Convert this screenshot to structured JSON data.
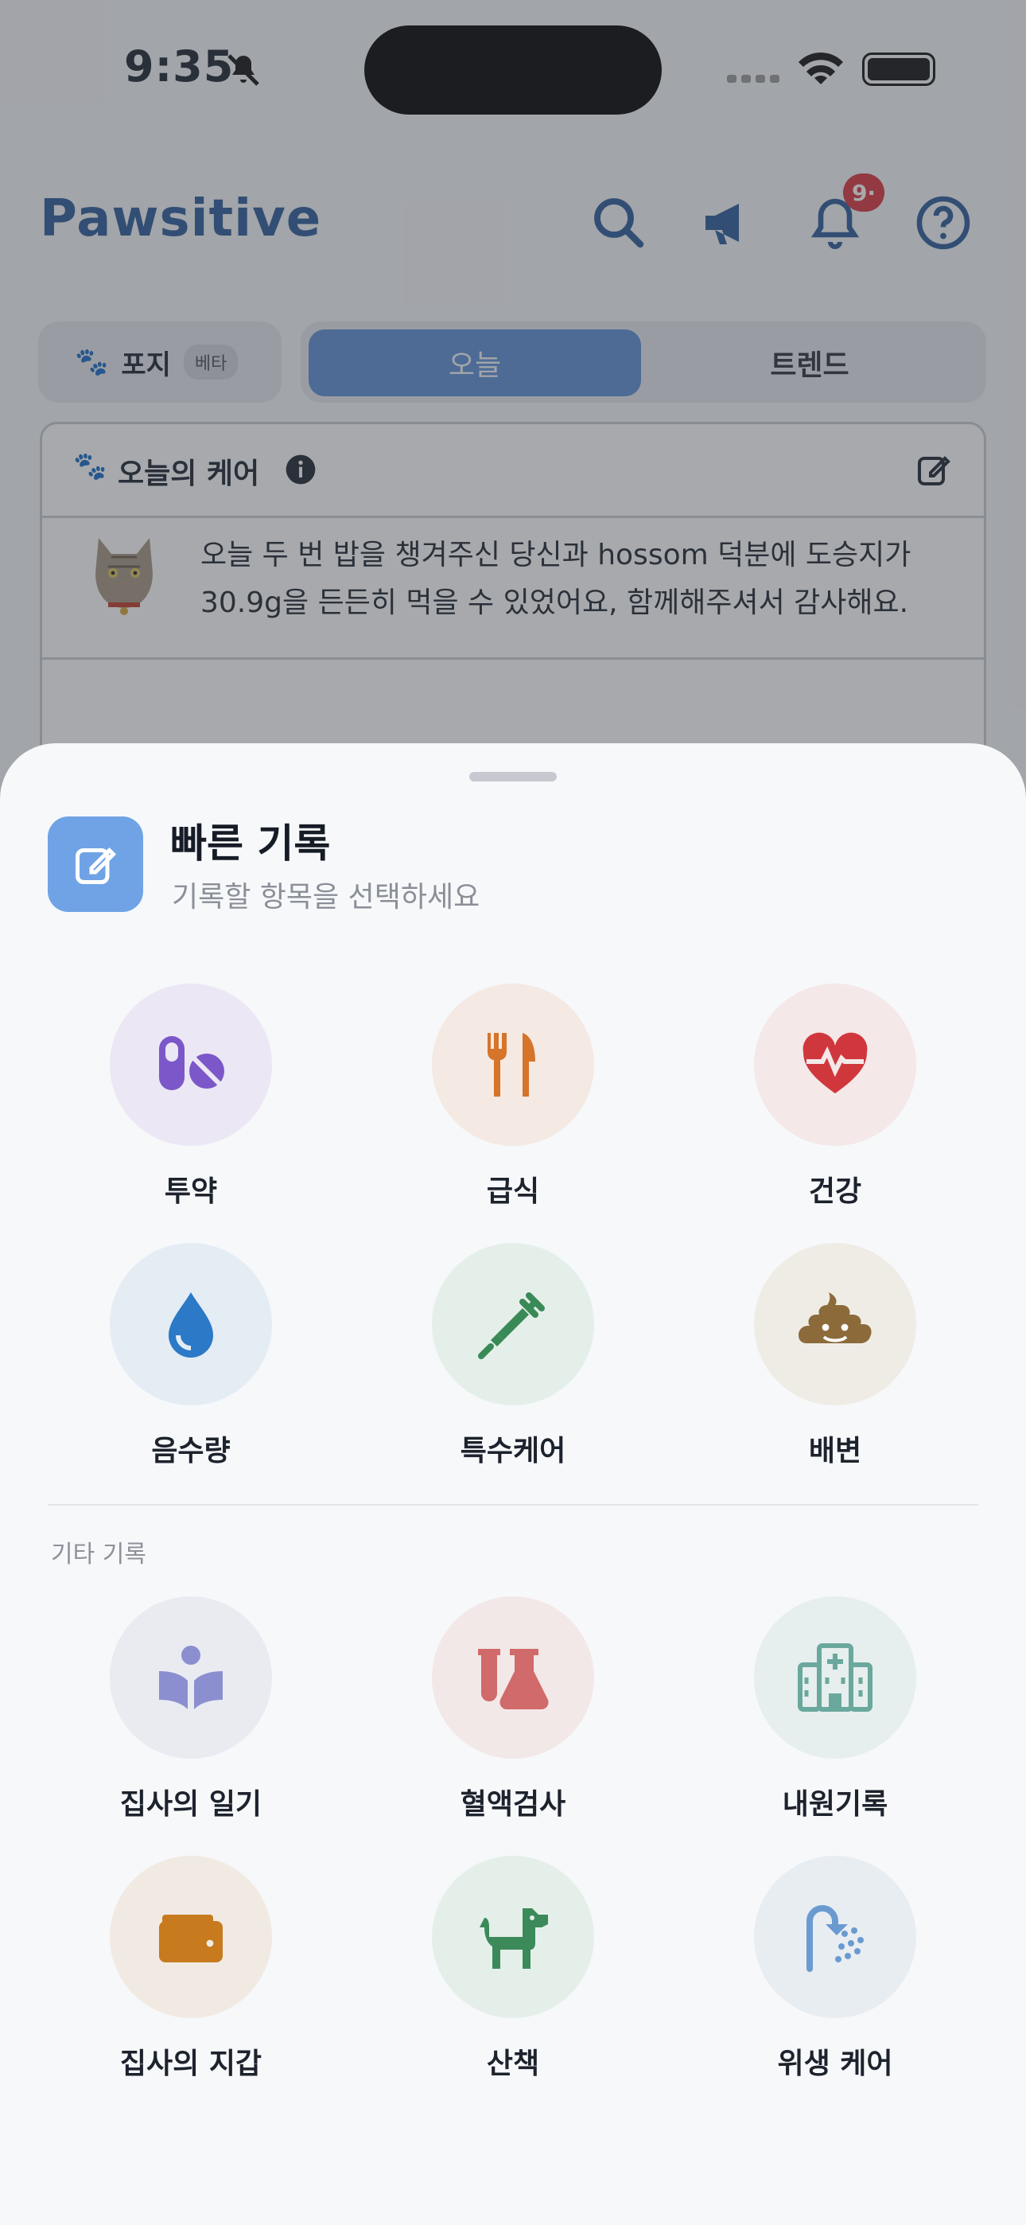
{
  "status_bar": {
    "time": "9:35"
  },
  "app": {
    "brand": "Pawsitive",
    "notification_count": "9·",
    "pet": {
      "name": "포지",
      "tag": "베타"
    },
    "view_tabs": [
      {
        "label": "오늘",
        "selected": true
      },
      {
        "label": "트렌드",
        "selected": false
      }
    ],
    "care_card": {
      "title": "오늘의 케어",
      "message": "오늘 두 번 밥을 챙겨주신 당신과 hossom 덕분에 도승지가 30.9g을 든든히 먹을 수 있었어요, 함께해주셔서 감사해요."
    }
  },
  "sheet": {
    "title": "빠른 기록",
    "subtitle": "기록할 항목을 선택하세요",
    "primary_items": [
      {
        "label": "투약",
        "icon": "pills-icon",
        "color": "#7b57c9",
        "bg": "#ebe7f4"
      },
      {
        "label": "급식",
        "icon": "fork-knife-icon",
        "color": "#d6742a",
        "bg": "#f4e9e3"
      },
      {
        "label": "건강",
        "icon": "heart-pulse-icon",
        "color": "#d0373c",
        "bg": "#f4e8e8"
      },
      {
        "label": "음수량",
        "icon": "water-drop-icon",
        "color": "#2c79c7",
        "bg": "#e4ecf4"
      },
      {
        "label": "특수케어",
        "icon": "syringe-icon",
        "color": "#3a8a57",
        "bg": "#e5efea"
      },
      {
        "label": "배변",
        "icon": "poop-icon",
        "color": "#8c6a3a",
        "bg": "#efece6"
      }
    ],
    "section_label": "기타 기록",
    "other_items": [
      {
        "label": "집사의 일기",
        "icon": "reading-person-icon",
        "color": "#8b8fd0",
        "bg": "#eaebf1"
      },
      {
        "label": "혈액검사",
        "icon": "flask-icon",
        "color": "#d16a6a",
        "bg": "#f3e8e8"
      },
      {
        "label": "내원기록",
        "icon": "hospital-icon",
        "color": "#6aa89d",
        "bg": "#e6eeee"
      },
      {
        "label": "집사의 지갑",
        "icon": "wallet-icon",
        "color": "#c77b1e",
        "bg": "#f1eae3"
      },
      {
        "label": "산책",
        "icon": "dog-icon",
        "color": "#3c8a5a",
        "bg": "#e5efea"
      },
      {
        "label": "위생 케어",
        "icon": "shower-icon",
        "color": "#6a9bd0",
        "bg": "#e8edf2"
      }
    ]
  }
}
